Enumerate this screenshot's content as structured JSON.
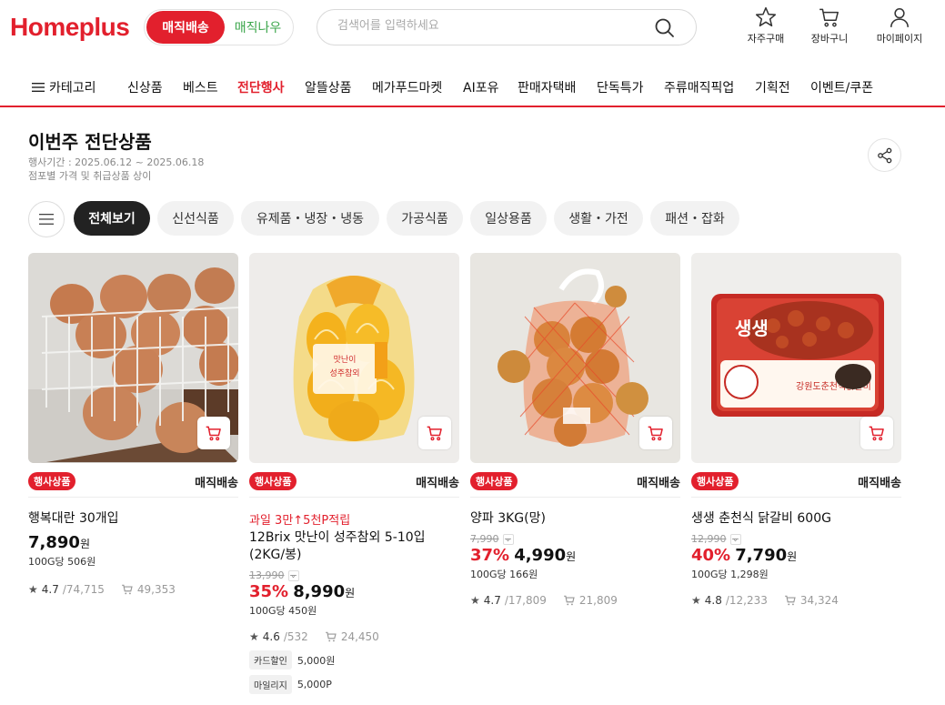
{
  "header": {
    "logo": "Homeplus",
    "mode_active": "매직배송",
    "mode_inactive": "매직나우",
    "search_placeholder": "검색어를 입력하세요",
    "icons": [
      {
        "label": "자주구매",
        "icon": "star-icon"
      },
      {
        "label": "장바구니",
        "icon": "cart-icon"
      },
      {
        "label": "마이페이지",
        "icon": "user-icon"
      }
    ]
  },
  "nav": {
    "category": "카테고리",
    "items": [
      "신상품",
      "베스트",
      "전단행사",
      "알뜰상품",
      "메가푸드마켓",
      "AI포유",
      "판매자택배",
      "단독특가",
      "주류매직픽업",
      "기획전",
      "이벤트/쿠폰"
    ],
    "active": "전단행사"
  },
  "page": {
    "title": "이번주 전단상품",
    "period": "행사기간 : 2025.06.12 ~ 2025.06.18",
    "note": "점포별 가격 및 취급상품 상이"
  },
  "filters": [
    "전체보기",
    "신선식품",
    "유제품・냉장・냉동",
    "가공식품",
    "일상용품",
    "생활・가전",
    "패션・잡화"
  ],
  "filter_active": "전체보기",
  "products": [
    {
      "badge": "행사상품",
      "delivery": "매직배송",
      "promo": "",
      "name": "행복대란 30개입",
      "original_price": "",
      "discount": "",
      "price": "7,890",
      "won": "원",
      "unit_price": "100G당 506원",
      "rating": "4.7",
      "reviews": "/74,715",
      "cart_count": "49,353",
      "benefits": []
    },
    {
      "badge": "행사상품",
      "delivery": "매직배송",
      "promo": "과일 3만↑5천P적립",
      "name": "12Brix 맛난이 성주참외 5-10입(2KG/봉)",
      "original_price": "13,990",
      "discount": "35%",
      "price": "8,990",
      "won": "원",
      "unit_price": "100G당 450원",
      "rating": "4.6",
      "reviews": "/532",
      "cart_count": "24,450",
      "benefits": [
        {
          "tag": "카드할인",
          "value": "5,000원"
        },
        {
          "tag": "마일리지",
          "value": "5,000P"
        }
      ]
    },
    {
      "badge": "행사상품",
      "delivery": "매직배송",
      "promo": "",
      "name": "양파 3KG(망)",
      "original_price": "7,990",
      "discount": "37%",
      "price": "4,990",
      "won": "원",
      "unit_price": "100G당 166원",
      "rating": "4.7",
      "reviews": "/17,809",
      "cart_count": "21,809",
      "benefits": []
    },
    {
      "badge": "행사상품",
      "delivery": "매직배송",
      "promo": "",
      "name": "생생 춘천식 닭갈비 600G",
      "original_price": "12,990",
      "discount": "40%",
      "price": "7,790",
      "won": "원",
      "unit_price": "100G당 1,298원",
      "rating": "4.8",
      "reviews": "/12,233",
      "cart_count": "34,324",
      "benefits": []
    }
  ],
  "colors": {
    "brand": "#e2202d",
    "accent_green": "#3aa54a",
    "chip_active": "#222222"
  }
}
